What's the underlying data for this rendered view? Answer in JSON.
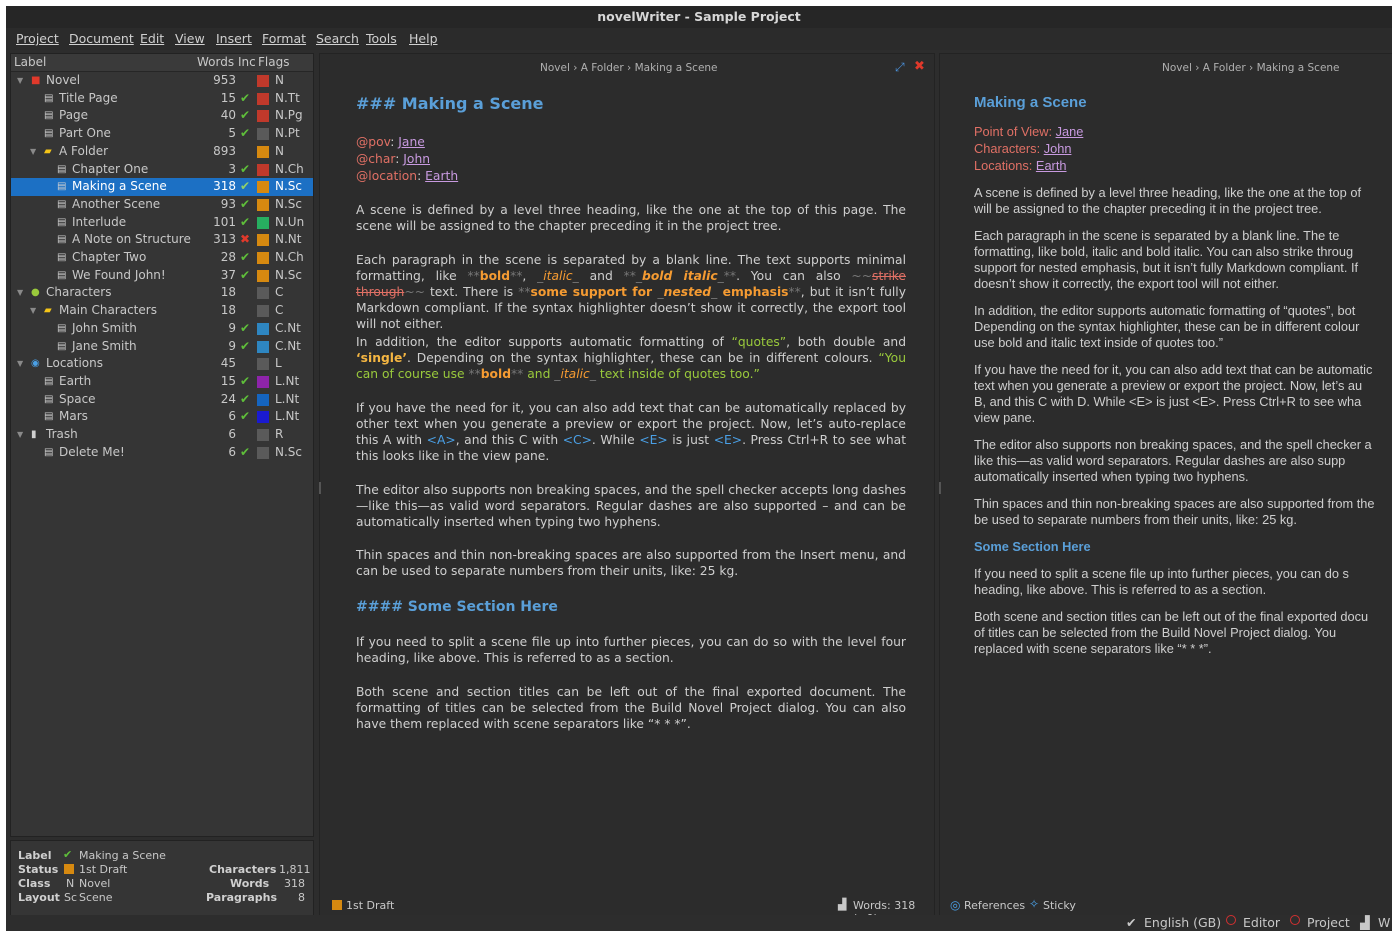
{
  "window": {
    "title": "novelWriter - Sample Project"
  },
  "menu": [
    "Project",
    "Document",
    "Edit",
    "View",
    "Insert",
    "Format",
    "Search",
    "Tools",
    "Help"
  ],
  "tree": {
    "headers": {
      "label": "Label",
      "words": "Words",
      "inc": "Inc",
      "flags": "Flags"
    },
    "rows": [
      {
        "label": "Novel",
        "count": "953",
        "status": "",
        "flag": "N",
        "color": "#c0392b"
      },
      {
        "label": "Title Page",
        "count": "15",
        "status": "✔",
        "flag": "N.Tt",
        "color": "#c0392b"
      },
      {
        "label": "Page",
        "count": "40",
        "status": "✔",
        "flag": "N.Pg",
        "color": "#c0392b"
      },
      {
        "label": "Part One",
        "count": "5",
        "status": "✔",
        "flag": "N.Pt",
        "color": "#5a5a5a"
      },
      {
        "label": "A Folder",
        "count": "893",
        "status": "",
        "flag": "N",
        "color": "#d68910"
      },
      {
        "label": "Chapter One",
        "count": "3",
        "status": "✔",
        "flag": "N.Ch",
        "color": "#c0392b"
      },
      {
        "label": "Making a Scene",
        "count": "318",
        "status": "✔",
        "flag": "N.Sc",
        "color": "#d68910"
      },
      {
        "label": "Another Scene",
        "count": "93",
        "status": "✔",
        "flag": "N.Sc",
        "color": "#d68910"
      },
      {
        "label": "Interlude",
        "count": "101",
        "status": "✔",
        "flag": "N.Un",
        "color": "#27ae60"
      },
      {
        "label": "A Note on Structure",
        "count": "313",
        "status": "✖",
        "flag": "N.Nt",
        "color": "#d68910"
      },
      {
        "label": "Chapter Two",
        "count": "28",
        "status": "✔",
        "flag": "N.Ch",
        "color": "#d68910"
      },
      {
        "label": "We Found John!",
        "count": "37",
        "status": "✔",
        "flag": "N.Sc",
        "color": "#d68910"
      },
      {
        "label": "Characters",
        "count": "18",
        "status": "",
        "flag": "C",
        "color": "#5a5a5a"
      },
      {
        "label": "Main Characters",
        "count": "18",
        "status": "",
        "flag": "C",
        "color": "#5a5a5a"
      },
      {
        "label": "John Smith",
        "count": "9",
        "status": "✔",
        "flag": "C.Nt",
        "color": "#2e86c1"
      },
      {
        "label": "Jane Smith",
        "count": "9",
        "status": "✔",
        "flag": "C.Nt",
        "color": "#2e86c1"
      },
      {
        "label": "Locations",
        "count": "45",
        "status": "",
        "flag": "L",
        "color": "#5a5a5a"
      },
      {
        "label": "Earth",
        "count": "15",
        "status": "✔",
        "flag": "L.Nt",
        "color": "#8e24aa"
      },
      {
        "label": "Space",
        "count": "24",
        "status": "✔",
        "flag": "L.Nt",
        "color": "#1565c0"
      },
      {
        "label": "Mars",
        "count": "6",
        "status": "✔",
        "flag": "L.Nt",
        "color": "#1a1ad0"
      },
      {
        "label": "Trash",
        "count": "6",
        "status": "",
        "flag": "R",
        "color": "#5a5a5a"
      },
      {
        "label": "Delete Me!",
        "count": "6",
        "status": "✔",
        "flag": "N.Sc",
        "color": "#5a5a5a"
      }
    ]
  },
  "details": {
    "label_key": "Label",
    "label_val": "Making a Scene",
    "status_key": "Status",
    "status_val": "1st Draft",
    "class_key": "Class",
    "class_code": "N",
    "class_val": "Novel",
    "layout_key": "Layout",
    "layout_code": "Sc",
    "layout_val": "Scene",
    "chars_key": "Characters",
    "chars_val": "1,811",
    "words_key": "Words",
    "words_val": "318",
    "paras_key": "Paragraphs",
    "paras_val": "8"
  },
  "editor": {
    "breadcrumb": "Novel › A Folder › Making a Scene",
    "title": "### Making a Scene",
    "meta": {
      "pov_key": "@pov",
      "pov_val": "Jane",
      "char_key": "@char",
      "char_val": "John",
      "loc_key": "@location",
      "loc_val": "Earth"
    },
    "p1": "A scene is defined by a level three heading, like the one at the top of this page. The scene will be assigned to the chapter preceding it in the project tree.",
    "p2": {
      "a": "Each paragraph in the scene is separated by a blank line. The text supports minimal formatting, like ",
      "b1": "**",
      "b": "bold",
      "b2": "**",
      "c": ", ",
      "i1": "_",
      "i": "italic",
      "i2": "_",
      "d": " and ",
      "bi1": "**_",
      "bi": "bold italic",
      "bi2": "_**",
      "e": ". You can also ",
      "s1": "~~",
      "s": "strike through",
      "s2": "~~",
      "f": " text. There is ",
      "n1": "**",
      "n": "some support for ",
      "n3": "_",
      "nn": "nested",
      "n4": "_",
      "nt": " emphasis",
      "n2": "**",
      "g": ", but it isn’t fully Markdown compliant. If the syntax highlighter doesn’t show it correctly, the export tool will not either."
    },
    "p3": {
      "a": "In addition, the editor supports automatic formatting of ",
      "q1": "“quotes”",
      "b": ", both double and ",
      "q2": "‘single’",
      "c": ". Depending on the syntax highlighter, these can be in different colours. ",
      "q3a": "“You can of course use ",
      "b1": "**",
      "bold": "bold",
      "b2": "**",
      "q3b": " and ",
      "i1": "_",
      "italic": "italic",
      "i2": "_",
      "q3c": " text inside of quotes too.”"
    },
    "p4": {
      "a": "If you have the need for it, you can also add text that can be automatically replaced by other text when you generate a preview or export the project. Now, let’s auto-replace this A with ",
      "ta": "<A>",
      "b": ", and this C with ",
      "tc": "<C>",
      "c": ".  While ",
      "te": "<E>",
      "d": " is just ",
      "te2": "<E>",
      "e": ". Press Ctrl+R to see what this looks like in the view pane."
    },
    "p5": "The editor also supports non breaking spaces, and the spell checker accepts long dashes—like this—as valid word separators. Regular dashes are also supported – and can be automatically inserted when typing two hyphens.",
    "p6": "Thin spaces and thin non-breaking spaces are also supported from the Insert menu, and can be used to separate numbers from their units, like: 25 kg.",
    "section": "#### Some Section Here",
    "p7": "If you need to split a scene file up into further pieces, you can do so with the level four heading, like above. This is referred to as a section.",
    "p8": "Both scene and section titles can be left out of the final exported document. The formatting of titles can be selected from the Build Novel Project dialog. You can also have them replaced with scene separators like “* * *”.",
    "status_label": "1st Draft",
    "word_count": "Words: 318 (+0)"
  },
  "viewer": {
    "breadcrumb": "Novel › A Folder › Making a Scene",
    "title": "Making a Scene",
    "pov_key": "Point of View:",
    "pov_val": "Jane",
    "char_key": "Characters:",
    "char_val": "John",
    "loc_key": "Locations:",
    "loc_val": "Earth",
    "lines": [
      "A scene is defined by a level three heading, like the one at the top of",
      "will be assigned to the chapter preceding it in the project tree.",
      "Each paragraph in the scene is separated by a blank line. The te",
      "formatting, like bold, italic and bold italic. You can also strike throug",
      "support for nested emphasis, but it isn’t fully Markdown compliant. If",
      "doesn’t show it correctly, the export tool will not either.",
      "In addition, the editor supports automatic formatting of “quotes”, bot",
      "Depending on the syntax highlighter, these can be in different colour",
      "use bold and italic text inside of quotes too.”",
      "If you have the need for it, you can also add text that can be automatic",
      "text when you generate a preview or export the project. Now, let’s au",
      "B, and this C with D. While <E> is just <E>. Press Ctrl+R to see wha",
      "view pane.",
      "The editor also supports non breaking spaces, and the spell checker a",
      "like this—as valid word separators. Regular dashes are also supp",
      "automatically inserted when typing two hyphens.",
      "Thin spaces and thin non-breaking spaces are also supported from the",
      "be used to separate numbers from their units, like: 25 kg.",
      "If you need to split a scene file up into further pieces, you can do s",
      "heading, like above. This is referred to as a section.",
      "Both scene and section titles can be left out of the final exported docu",
      "of titles can be selected from the Build Novel Project dialog. You",
      "replaced with scene separators like “* * *”."
    ],
    "section": "Some Section Here",
    "references": "References",
    "sticky": "Sticky"
  },
  "statusbar": {
    "language": "English (GB)",
    "editor": "Editor",
    "project": "Project",
    "words": "W"
  }
}
